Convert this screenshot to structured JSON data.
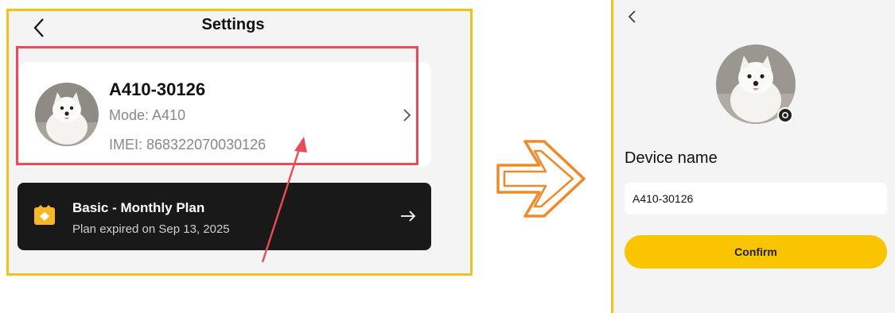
{
  "left_screen": {
    "title": "Settings",
    "device": {
      "name": "A410-30126",
      "mode": "Mode: A410",
      "imei": "IMEI: 868322070030126"
    },
    "plan": {
      "title": "Basic - Monthly Plan",
      "subtitle": "Plan expired on Sep 13, 2025"
    }
  },
  "right_screen": {
    "heading": "Device name",
    "input_value": "A410-30126",
    "confirm_label": "Confirm"
  },
  "colors": {
    "panel_border": "#f5c017",
    "highlight": "#ea4b57",
    "transition_arrow": "#f08a28",
    "confirm": "#f9c400",
    "plan_card": "#191919"
  },
  "icons": {
    "back": "chevron-left-icon",
    "row_chevron": "chevron-right-icon",
    "plan": "plan-badge-icon",
    "plan_go": "arrow-right-icon",
    "camera": "camera-icon",
    "transition": "arrow-right-outline-icon"
  }
}
